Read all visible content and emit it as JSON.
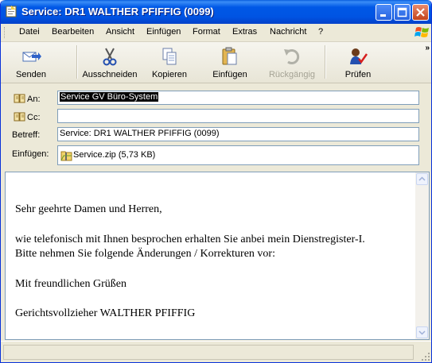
{
  "window": {
    "title": "Service: DR1 WALTHER PFIFFIG (0099)"
  },
  "menu": [
    "Datei",
    "Bearbeiten",
    "Ansicht",
    "Einfügen",
    "Format",
    "Extras",
    "Nachricht",
    "?"
  ],
  "toolbar": {
    "send": "Senden",
    "cut": "Ausschneiden",
    "copy": "Kopieren",
    "paste": "Einfügen",
    "undo": "Rückgängig",
    "check": "Prüfen",
    "overflow": "»"
  },
  "header": {
    "to_label": "An:",
    "to_value": "Service GV Büro-System",
    "cc_label": "Cc:",
    "cc_value": "",
    "subject_label": "Betreff:",
    "subject_value": "Service: DR1 WALTHER PFIFFIG (0099)",
    "attach_label": "Einfügen:",
    "attach_value": "Service.zip (5,73 KB)"
  },
  "body": {
    "greeting": "Sehr geehrte Damen und Herren,",
    "line1": "wie telefonisch mit Ihnen besprochen erhalten Sie anbei mein Dienstregister-I.",
    "line2": "Bitte nehmen Sie folgende Änderungen / Korrekturen vor:",
    "closing": "Mit freundlichen Grüßen",
    "signature": "Gerichtsvollzieher WALTHER PFIFFIG"
  },
  "icons": {
    "app": "envelope-icon",
    "send": "send-icon",
    "cut": "scissors-icon",
    "copy": "copy-icon",
    "paste": "paste-icon",
    "undo": "undo-icon",
    "check": "spellcheck-icon",
    "address_book": "address-book-icon",
    "attachment": "zip-file-icon"
  },
  "colors": {
    "titlebar": "#0054e3",
    "window_bg": "#ece9d8",
    "field_border": "#7f9db9",
    "close_button": "#c3431b"
  }
}
